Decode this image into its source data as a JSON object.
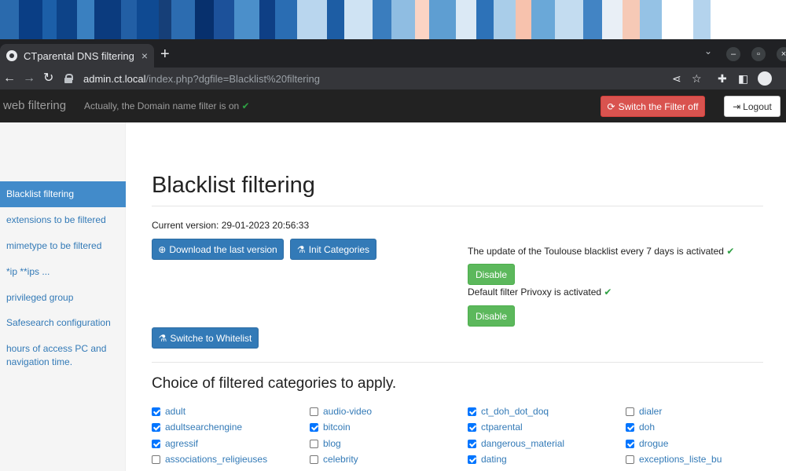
{
  "wallpaper": {
    "colors": [
      "#2a6aad",
      "#0a3e85",
      "#1c5fa8",
      "#0d4388",
      "#3a80c0",
      "#0b3b7e",
      "#225fa5",
      "#0f4a92",
      "#163f78",
      "#2c6cb0",
      "#07306d",
      "#1c519a",
      "#4b8fca",
      "#0e3f85",
      "#2a6db3",
      "#b9d6ee",
      "#1d5da4",
      "#cfe3f3",
      "#3a7dbe",
      "#8fbde2",
      "#fbd4c4",
      "#5e9ed2",
      "#dbe9f5",
      "#2d72b8",
      "#a9cde9",
      "#f7c2ad",
      "#6aa8d8",
      "#c3dcf0",
      "#4284c4",
      "#e9eff6",
      "#f6c9b6",
      "#95c2e5",
      "#ffffff",
      "#b4d3ed"
    ],
    "widths": [
      24,
      30,
      18,
      26,
      22,
      34,
      20,
      28,
      16,
      30,
      24,
      26,
      32,
      20,
      28,
      38,
      22,
      36,
      24,
      30,
      18,
      34,
      26,
      22,
      28,
      20,
      30,
      36,
      24,
      26,
      22,
      28,
      40,
      22
    ]
  },
  "browser": {
    "tab_title": "CTparental DNS filtering",
    "tab_close": "×",
    "new_tab": "+",
    "url_host": "admin.ct.local",
    "url_path": "/index.php?dgfile=Blacklist%20filtering"
  },
  "navbar": {
    "brand": "web filtering",
    "status": "Actually, the Domain name filter is on",
    "status_check": "✔",
    "filter_off_button": "Switch the Filter off",
    "logout_button": "Logout"
  },
  "sidebar": {
    "items": [
      {
        "label": "Blacklist filtering"
      },
      {
        "label": "extensions to be filtered"
      },
      {
        "label": "mimetype to be filtered"
      },
      {
        "label": "*ip **ips ..."
      },
      {
        "label": "privileged group"
      },
      {
        "label": "Safesearch configuration"
      },
      {
        "label": "hours of access PC and navigation time."
      }
    ]
  },
  "main": {
    "title": "Blacklist filtering",
    "version": "Current version: 29-01-2023 20:56:33",
    "download_button": "Download the last version",
    "init_button": "Init Categories",
    "whitelist_button": "Switche to Whitelist",
    "update_info": "The update of the Toulouse blacklist every 7 days is activated",
    "privoxy_info": "Default filter Privoxy is activated",
    "check": "✔",
    "disable_button": "Disable",
    "categories_title": "Choice of filtered categories to apply."
  },
  "categories": [
    [
      {
        "label": "adult",
        "checked": true
      },
      {
        "label": "adultsearchengine",
        "checked": true
      },
      {
        "label": "agressif",
        "checked": true
      },
      {
        "label": "associations_religieuses",
        "checked": false
      }
    ],
    [
      {
        "label": "audio-video",
        "checked": false
      },
      {
        "label": "bitcoin",
        "checked": true
      },
      {
        "label": "blog",
        "checked": false
      },
      {
        "label": "celebrity",
        "checked": false
      }
    ],
    [
      {
        "label": "ct_doh_dot_doq",
        "checked": true
      },
      {
        "label": "ctparental",
        "checked": true
      },
      {
        "label": "dangerous_material",
        "checked": true
      },
      {
        "label": "dating",
        "checked": true
      }
    ],
    [
      {
        "label": "dialer",
        "checked": false
      },
      {
        "label": "doh",
        "checked": true
      },
      {
        "label": "drogue",
        "checked": true
      },
      {
        "label": "exceptions_liste_bu",
        "checked": false
      }
    ]
  ]
}
